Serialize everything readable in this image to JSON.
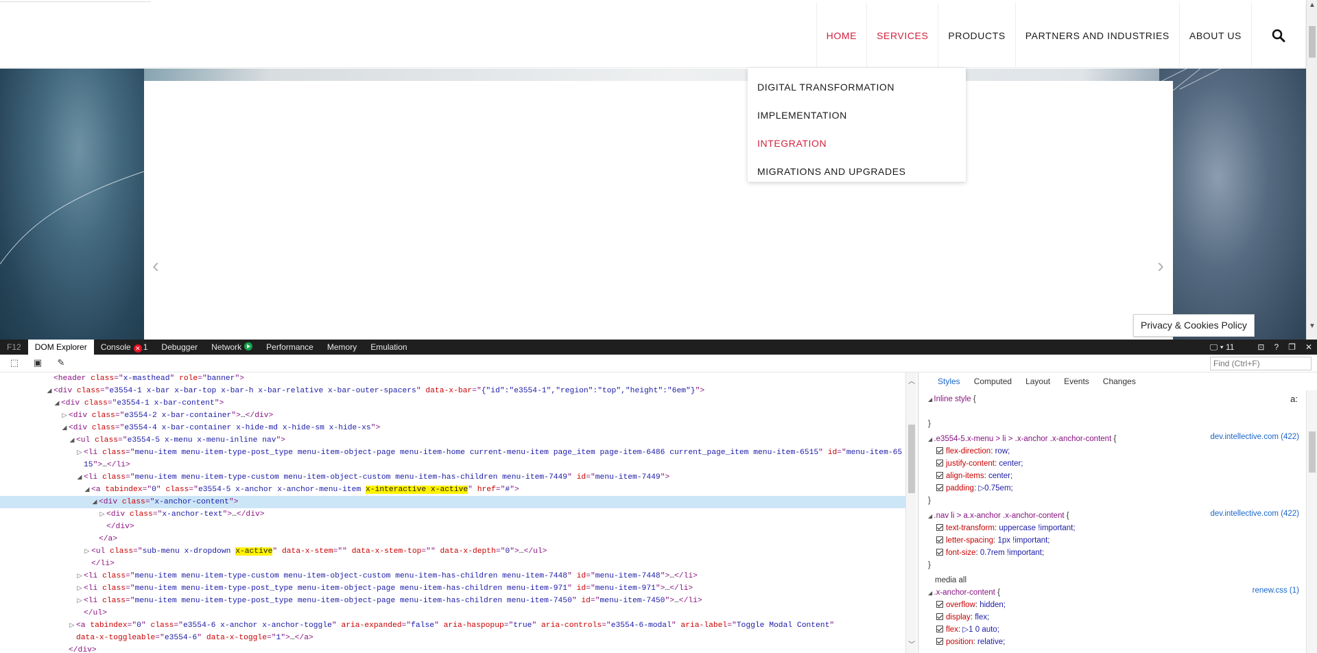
{
  "site": {
    "nav": [
      {
        "label": "HOME",
        "active": true
      },
      {
        "label": "SERVICES",
        "active": true
      },
      {
        "label": "PRODUCTS",
        "active": false
      },
      {
        "label": "PARTNERS AND INDUSTRIES",
        "active": false
      },
      {
        "label": "ABOUT US",
        "active": false
      }
    ],
    "dropdown": [
      {
        "label": "DIGITAL TRANSFORMATION",
        "active": false
      },
      {
        "label": "IMPLEMENTATION",
        "active": false
      },
      {
        "label": "INTEGRATION",
        "active": true
      },
      {
        "label": "MIGRATIONS AND UPGRADES",
        "active": false
      }
    ],
    "slider_prev": "‹",
    "slider_next": "›",
    "privacy_label": "Privacy & Cookies Policy",
    "accent_color": "#d0213d"
  },
  "devtools": {
    "f12_label": "F12",
    "tabs": [
      "DOM Explorer",
      "Console",
      "Debugger",
      "Network",
      "Performance",
      "Memory",
      "Emulation"
    ],
    "console_errors": "1",
    "doc_mode": "11",
    "find_placeholder": "Find (Ctrl+F)",
    "styles_tabs": [
      "Styles",
      "Computed",
      "Layout",
      "Events",
      "Changes"
    ],
    "dom_lines": [
      {
        "indent": 6,
        "tw": "",
        "parts": [
          [
            "t",
            "<header "
          ],
          [
            "an",
            "class"
          ],
          [
            "t",
            "=\""
          ],
          [
            "av",
            "x-masthead"
          ],
          [
            "t",
            "\" "
          ],
          [
            "an",
            "role"
          ],
          [
            "t",
            "=\""
          ],
          [
            "av",
            "banner"
          ],
          [
            "t",
            "\">"
          ]
        ]
      },
      {
        "indent": 6,
        "tw": "◢",
        "parts": [
          [
            "t",
            "<div "
          ],
          [
            "an",
            "class"
          ],
          [
            "t",
            "=\""
          ],
          [
            "av",
            "e3554-1 x-bar x-bar-top x-bar-h x-bar-relative x-bar-outer-spacers"
          ],
          [
            "t",
            "\" "
          ],
          [
            "an",
            "data-x-bar"
          ],
          [
            "t",
            "=\""
          ],
          [
            "av",
            "{\"id\":\"e3554-1\",\"region\":\"top\",\"height\":\"6em\"}"
          ],
          [
            "t",
            "\">"
          ]
        ]
      },
      {
        "indent": 7,
        "tw": "◢",
        "parts": [
          [
            "t",
            "<div "
          ],
          [
            "an",
            "class"
          ],
          [
            "t",
            "=\""
          ],
          [
            "av",
            "e3554-1 x-bar-content"
          ],
          [
            "t",
            "\">"
          ]
        ]
      },
      {
        "indent": 8,
        "tw": "▷",
        "parts": [
          [
            "t",
            "<div "
          ],
          [
            "an",
            "class"
          ],
          [
            "t",
            "=\""
          ],
          [
            "av",
            "e3554-2 x-bar-container"
          ],
          [
            "t",
            "\">"
          ],
          [
            "txt",
            "…"
          ],
          [
            "t",
            "</div>"
          ]
        ]
      },
      {
        "indent": 8,
        "tw": "◢",
        "parts": [
          [
            "t",
            "<div "
          ],
          [
            "an",
            "class"
          ],
          [
            "t",
            "=\""
          ],
          [
            "av",
            "e3554-4 x-bar-container x-hide-md x-hide-sm x-hide-xs"
          ],
          [
            "t",
            "\">"
          ]
        ]
      },
      {
        "indent": 9,
        "tw": "◢",
        "parts": [
          [
            "t",
            "<ul "
          ],
          [
            "an",
            "class"
          ],
          [
            "t",
            "=\""
          ],
          [
            "av",
            "e3554-5 x-menu x-menu-inline nav"
          ],
          [
            "t",
            "\">"
          ]
        ]
      },
      {
        "indent": 10,
        "tw": "▷",
        "parts": [
          [
            "t",
            "<li "
          ],
          [
            "an",
            "class"
          ],
          [
            "t",
            "=\""
          ],
          [
            "av",
            "menu-item menu-item-type-post_type menu-item-object-page menu-item-home current-menu-item page_item page-item-6486 current_page_item menu-item-6515"
          ],
          [
            "t",
            "\" "
          ],
          [
            "an",
            "id"
          ],
          [
            "t",
            "=\""
          ],
          [
            "av",
            "menu-item-65"
          ]
        ]
      },
      {
        "indent": 10,
        "tw": "",
        "parts": [
          [
            "av",
            "15"
          ],
          [
            "t",
            "\">"
          ],
          [
            "txt",
            "…"
          ],
          [
            "t",
            "</li>"
          ]
        ]
      },
      {
        "indent": 10,
        "tw": "◢",
        "parts": [
          [
            "t",
            "<li "
          ],
          [
            "an",
            "class"
          ],
          [
            "t",
            "=\""
          ],
          [
            "av",
            "menu-item menu-item-type-custom menu-item-object-custom menu-item-has-children menu-item-7449"
          ],
          [
            "t",
            "\" "
          ],
          [
            "an",
            "id"
          ],
          [
            "t",
            "=\""
          ],
          [
            "av",
            "menu-item-7449"
          ],
          [
            "t",
            "\">"
          ]
        ]
      },
      {
        "indent": 11,
        "tw": "◢",
        "parts": [
          [
            "t",
            "<a "
          ],
          [
            "an",
            "tabindex"
          ],
          [
            "t",
            "=\""
          ],
          [
            "av",
            "0"
          ],
          [
            "t",
            "\" "
          ],
          [
            "an",
            "class"
          ],
          [
            "t",
            "=\""
          ],
          [
            "av",
            "e3554-5 x-anchor x-anchor-menu-item "
          ],
          [
            "hl",
            "x-interactive x-active"
          ],
          [
            "t",
            "\" "
          ],
          [
            "an",
            "href"
          ],
          [
            "t",
            "=\""
          ],
          [
            "av",
            "#"
          ],
          [
            "t",
            "\">"
          ]
        ]
      },
      {
        "indent": 12,
        "tw": "◢",
        "sel": true,
        "parts": [
          [
            "t",
            "<div "
          ],
          [
            "an",
            "class"
          ],
          [
            "t",
            "=\""
          ],
          [
            "av",
            "x-anchor-content"
          ],
          [
            "t",
            "\">"
          ]
        ]
      },
      {
        "indent": 13,
        "tw": "▷",
        "parts": [
          [
            "t",
            "<div "
          ],
          [
            "an",
            "class"
          ],
          [
            "t",
            "=\""
          ],
          [
            "av",
            "x-anchor-text"
          ],
          [
            "t",
            "\">"
          ],
          [
            "txt",
            "…"
          ],
          [
            "t",
            "</div>"
          ]
        ]
      },
      {
        "indent": 13,
        "tw": "",
        "parts": [
          [
            "t",
            "</div>"
          ]
        ]
      },
      {
        "indent": 12,
        "tw": "",
        "parts": [
          [
            "t",
            "</a>"
          ]
        ]
      },
      {
        "indent": 11,
        "tw": "▷",
        "parts": [
          [
            "t",
            "<ul "
          ],
          [
            "an",
            "class"
          ],
          [
            "t",
            "=\""
          ],
          [
            "av",
            "sub-menu x-dropdown "
          ],
          [
            "hl",
            "x-active"
          ],
          [
            "t",
            "\" "
          ],
          [
            "an",
            "data-x-stem"
          ],
          [
            "t",
            "=\"\" "
          ],
          [
            "an",
            "data-x-stem-top"
          ],
          [
            "t",
            "=\"\" "
          ],
          [
            "an",
            "data-x-depth"
          ],
          [
            "t",
            "=\""
          ],
          [
            "av",
            "0"
          ],
          [
            "t",
            "\">"
          ],
          [
            "txt",
            "…"
          ],
          [
            "t",
            "</ul>"
          ]
        ]
      },
      {
        "indent": 11,
        "tw": "",
        "parts": [
          [
            "t",
            "</li>"
          ]
        ]
      },
      {
        "indent": 10,
        "tw": "▷",
        "parts": [
          [
            "t",
            "<li "
          ],
          [
            "an",
            "class"
          ],
          [
            "t",
            "=\""
          ],
          [
            "av",
            "menu-item menu-item-type-custom menu-item-object-custom menu-item-has-children menu-item-7448"
          ],
          [
            "t",
            "\" "
          ],
          [
            "an",
            "id"
          ],
          [
            "t",
            "=\""
          ],
          [
            "av",
            "menu-item-7448"
          ],
          [
            "t",
            "\">"
          ],
          [
            "txt",
            "…"
          ],
          [
            "t",
            "</li>"
          ]
        ]
      },
      {
        "indent": 10,
        "tw": "▷",
        "parts": [
          [
            "t",
            "<li "
          ],
          [
            "an",
            "class"
          ],
          [
            "t",
            "=\""
          ],
          [
            "av",
            "menu-item menu-item-type-post_type menu-item-object-page menu-item-has-children menu-item-971"
          ],
          [
            "t",
            "\" "
          ],
          [
            "an",
            "id"
          ],
          [
            "t",
            "=\""
          ],
          [
            "av",
            "menu-item-971"
          ],
          [
            "t",
            "\">"
          ],
          [
            "txt",
            "…"
          ],
          [
            "t",
            "</li>"
          ]
        ]
      },
      {
        "indent": 10,
        "tw": "▷",
        "parts": [
          [
            "t",
            "<li "
          ],
          [
            "an",
            "class"
          ],
          [
            "t",
            "=\""
          ],
          [
            "av",
            "menu-item menu-item-type-post_type menu-item-object-page menu-item-has-children menu-item-7450"
          ],
          [
            "t",
            "\" "
          ],
          [
            "an",
            "id"
          ],
          [
            "t",
            "=\""
          ],
          [
            "av",
            "menu-item-7450"
          ],
          [
            "t",
            "\">"
          ],
          [
            "txt",
            "…"
          ],
          [
            "t",
            "</li>"
          ]
        ]
      },
      {
        "indent": 10,
        "tw": "",
        "parts": [
          [
            "t",
            "</ul>"
          ]
        ]
      },
      {
        "indent": 9,
        "tw": "▷",
        "parts": [
          [
            "t",
            "<a "
          ],
          [
            "an",
            "tabindex"
          ],
          [
            "t",
            "=\""
          ],
          [
            "av",
            "0"
          ],
          [
            "t",
            "\" "
          ],
          [
            "an",
            "class"
          ],
          [
            "t",
            "=\""
          ],
          [
            "av",
            "e3554-6 x-anchor x-anchor-toggle"
          ],
          [
            "t",
            "\" "
          ],
          [
            "an",
            "aria-expanded"
          ],
          [
            "t",
            "=\""
          ],
          [
            "av",
            "false"
          ],
          [
            "t",
            "\" "
          ],
          [
            "an",
            "aria-haspopup"
          ],
          [
            "t",
            "=\""
          ],
          [
            "av",
            "true"
          ],
          [
            "t",
            "\" "
          ],
          [
            "an",
            "aria-controls"
          ],
          [
            "t",
            "=\""
          ],
          [
            "av",
            "e3554-6-modal"
          ],
          [
            "t",
            "\" "
          ],
          [
            "an",
            "aria-label"
          ],
          [
            "t",
            "=\""
          ],
          [
            "av",
            "Toggle Modal Content"
          ],
          [
            "t",
            "\""
          ]
        ]
      },
      {
        "indent": 9,
        "tw": "",
        "parts": [
          [
            "an",
            "data-x-toggleable"
          ],
          [
            "t",
            "=\""
          ],
          [
            "av",
            "e3554-6"
          ],
          [
            "t",
            "\" "
          ],
          [
            "an",
            "data-x-toggle"
          ],
          [
            "t",
            "=\""
          ],
          [
            "av",
            "1"
          ],
          [
            "t",
            "\">"
          ],
          [
            "txt",
            "…"
          ],
          [
            "t",
            "</a>"
          ]
        ]
      },
      {
        "indent": 8,
        "tw": "",
        "parts": [
          [
            "t",
            "</div>"
          ]
        ]
      }
    ],
    "style_rules": [
      {
        "selector": "Inline style",
        "brace": " {",
        "source": "",
        "props": [],
        "close": true
      },
      {
        "selector": ".e3554-5.x-menu > li > .x-anchor .x-anchor-content",
        "brace": " {",
        "source": "dev.intellective.com (422)",
        "props": [
          [
            "flex-direction",
            "row;"
          ],
          [
            "justify-content",
            "center;"
          ],
          [
            "align-items",
            "center;"
          ],
          [
            "padding",
            "▷0.75em;"
          ]
        ],
        "close": true
      },
      {
        "selector": ".nav li > a.x-anchor .x-anchor-content",
        "brace": " {",
        "source": "dev.intellective.com (422)",
        "props": [
          [
            "text-transform",
            "uppercase !important;"
          ],
          [
            "letter-spacing",
            "1px !important;"
          ],
          [
            "font-size",
            "0.7rem !important;"
          ]
        ],
        "close": true
      },
      {
        "selector": "media all",
        "brace": "",
        "source": "",
        "props": [],
        "close": false,
        "media": true
      },
      {
        "selector": ".x-anchor-content",
        "brace": " {",
        "source": "renew.css (1)",
        "props": [
          [
            "overflow",
            "hidden;"
          ],
          [
            "display",
            "flex;"
          ],
          [
            "flex",
            "▷1 0 auto;"
          ],
          [
            "position",
            "relative;"
          ]
        ],
        "close": false
      }
    ]
  }
}
